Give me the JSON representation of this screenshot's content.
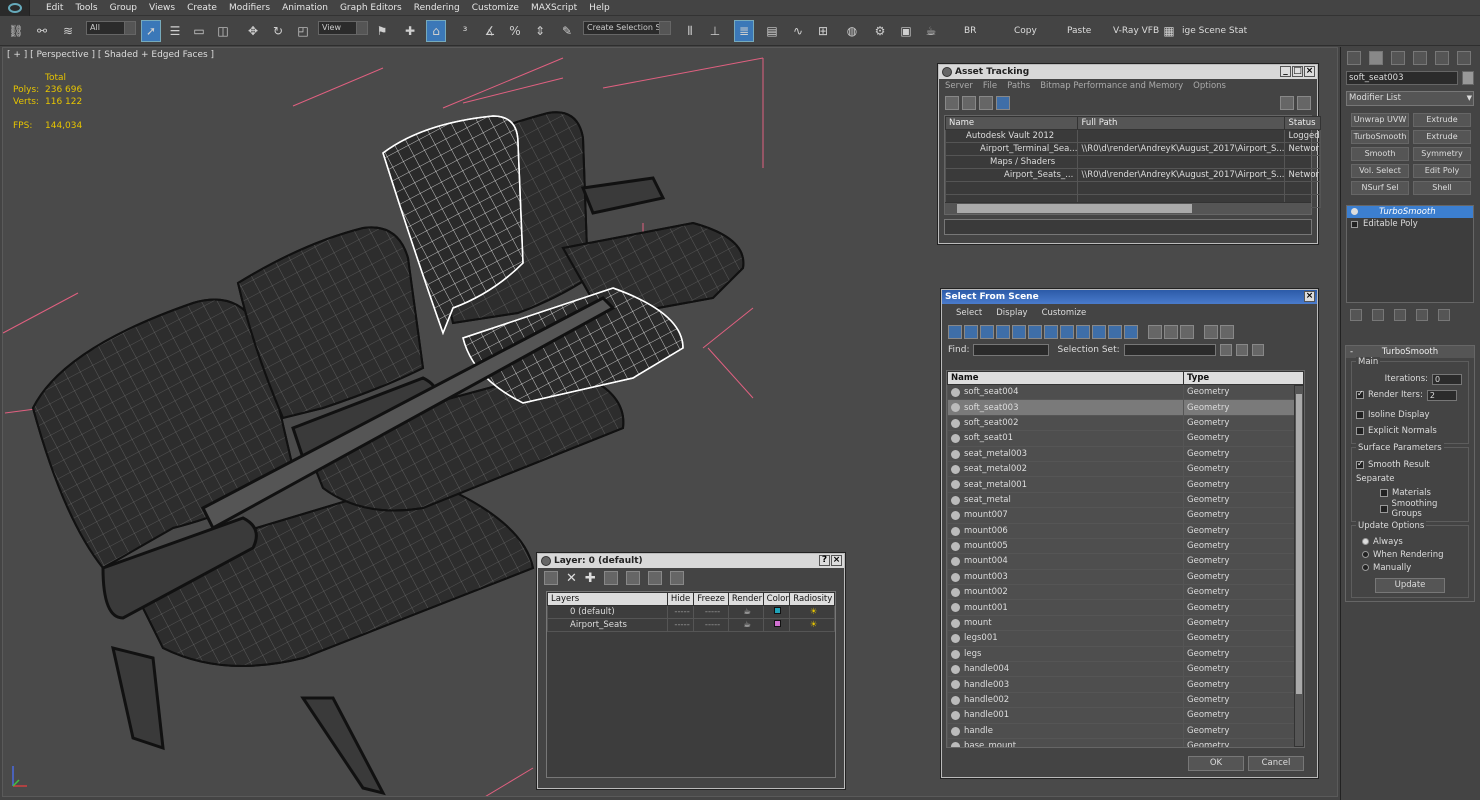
{
  "menubar": {
    "items": [
      "Edit",
      "Tools",
      "Group",
      "Views",
      "Create",
      "Modifiers",
      "Animation",
      "Graph Editors",
      "Rendering",
      "Customize",
      "MAXScript",
      "Help"
    ]
  },
  "toolbar": {
    "filter_value": "All",
    "refcoord_value": "View",
    "named_selection_placeholder": "Create Selection Se",
    "text_buttons": [
      "BR",
      "Copy",
      "Paste",
      "V-Ray VFB"
    ],
    "render_scene_label": "ige Scene Stat"
  },
  "viewport": {
    "label": "[ + ] [ Perspective ] [ Shaded + Edged Faces ]",
    "stats": {
      "header": "Total",
      "polys_label": "Polys:",
      "polys_value": "236 696",
      "verts_label": "Verts:",
      "verts_value": "116 122",
      "fps_label": "FPS:",
      "fps_value": "144,034"
    }
  },
  "asset_tracking": {
    "title": "Asset Tracking",
    "menus": [
      "Server",
      "File",
      "Paths",
      "Bitmap Performance and Memory",
      "Options"
    ],
    "columns": [
      "Name",
      "Full Path",
      "Status"
    ],
    "rows": [
      {
        "name": "Autodesk Vault 2012",
        "path": "",
        "status": "Logged"
      },
      {
        "name": "Airport_Terminal_Sea...",
        "path": "\\\\R0\\d\\render\\AndreyK\\August_2017\\Airport_S...",
        "status": "Networ"
      },
      {
        "name": "Maps / Shaders",
        "path": "",
        "status": ""
      },
      {
        "name": "Airport_Seats_...",
        "path": "\\\\R0\\d\\render\\AndreyK\\August_2017\\Airport_S...",
        "status": "Networ"
      }
    ]
  },
  "select_from_scene": {
    "title": "Select From Scene",
    "menus": [
      "Select",
      "Display",
      "Customize"
    ],
    "find_label": "Find:",
    "selection_set_label": "Selection Set:",
    "columns": [
      "Name",
      "Type"
    ],
    "rows": [
      {
        "name": "soft_seat004",
        "type": "Geometry"
      },
      {
        "name": "soft_seat003",
        "type": "Geometry"
      },
      {
        "name": "soft_seat002",
        "type": "Geometry"
      },
      {
        "name": "soft_seat01",
        "type": "Geometry"
      },
      {
        "name": "seat_metal003",
        "type": "Geometry"
      },
      {
        "name": "seat_metal002",
        "type": "Geometry"
      },
      {
        "name": "seat_metal001",
        "type": "Geometry"
      },
      {
        "name": "seat_metal",
        "type": "Geometry"
      },
      {
        "name": "mount007",
        "type": "Geometry"
      },
      {
        "name": "mount006",
        "type": "Geometry"
      },
      {
        "name": "mount005",
        "type": "Geometry"
      },
      {
        "name": "mount004",
        "type": "Geometry"
      },
      {
        "name": "mount003",
        "type": "Geometry"
      },
      {
        "name": "mount002",
        "type": "Geometry"
      },
      {
        "name": "mount001",
        "type": "Geometry"
      },
      {
        "name": "mount",
        "type": "Geometry"
      },
      {
        "name": "legs001",
        "type": "Geometry"
      },
      {
        "name": "legs",
        "type": "Geometry"
      },
      {
        "name": "handle004",
        "type": "Geometry"
      },
      {
        "name": "handle003",
        "type": "Geometry"
      },
      {
        "name": "handle002",
        "type": "Geometry"
      },
      {
        "name": "handle001",
        "type": "Geometry"
      },
      {
        "name": "handle",
        "type": "Geometry"
      },
      {
        "name": "base_mount",
        "type": "Geometry"
      }
    ],
    "ok_label": "OK",
    "cancel_label": "Cancel"
  },
  "layer_manager": {
    "title": "Layer: 0 (default)",
    "columns": [
      "Layers",
      "Hide",
      "Freeze",
      "Render",
      "Color",
      "Radiosity"
    ],
    "rows": [
      {
        "name": "0 (default)",
        "hide": "-----",
        "freeze": "-----",
        "color": "#1fa3b8"
      },
      {
        "name": "Airport_Seats",
        "hide": "-----",
        "freeze": "-----",
        "color": "#d070d0"
      }
    ]
  },
  "command_panel": {
    "object_name": "soft_seat003",
    "modifier_list_label": "Modifier List",
    "modifier_buttons": [
      "Unwrap UVW",
      "Extrude",
      "TurboSmooth",
      "Extrude",
      "Smooth",
      "Symmetry",
      "Vol. Select",
      "Edit Poly",
      "NSurf Sel",
      "Shell"
    ],
    "stack": [
      {
        "label": "TurboSmooth",
        "selected": true
      },
      {
        "label": "Editable Poly",
        "selected": false
      }
    ],
    "turbosmooth": {
      "title": "TurboSmooth",
      "main_label": "Main",
      "iterations_label": "Iterations:",
      "iterations_value": "0",
      "render_iters_label": "Render Iters:",
      "render_iters_value": "2",
      "isoline_label": "Isoline Display",
      "explicit_normals_label": "Explicit Normals",
      "surface_params_label": "Surface Parameters",
      "smooth_result_label": "Smooth Result",
      "separate_label": "Separate",
      "materials_label": "Materials",
      "smoothing_groups_label": "Smoothing Groups",
      "update_options_label": "Update Options",
      "always_label": "Always",
      "when_rendering_label": "When Rendering",
      "manually_label": "Manually",
      "update_button": "Update"
    }
  },
  "colors": {
    "accent_blue": "#3c7fd0",
    "stats_yellow": "#e6c400",
    "bbox_pink": "#e06080"
  }
}
